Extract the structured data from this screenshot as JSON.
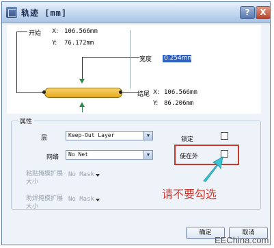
{
  "window": {
    "title": "轨迹 [mm]",
    "help_label": "?",
    "close_label": "X"
  },
  "drawing": {
    "start_label": "开始",
    "start_x_label": "X:",
    "start_x_value": "106.566mm",
    "start_y_label": "Y:",
    "start_y_value": "76.172mm",
    "width_label": "宽度",
    "width_value": "0.254mm",
    "end_label": "结尾",
    "end_x_label": "X:",
    "end_x_value": "106.566mm",
    "end_y_label": "Y:",
    "end_y_value": "86.206mm"
  },
  "properties": {
    "group_label": "属性",
    "layer_label": "层",
    "layer_value": "Keep-Out Layer",
    "net_label": "网络",
    "net_value": "No Net",
    "locked_label": "锁定",
    "keepout_label": "使在外",
    "paste_mask_label": "粘贴掩模扩展大小",
    "paste_mask_value": "No Mask",
    "solder_mask_label": "助焊掩模扩展大小",
    "solder_mask_value": "No Mask"
  },
  "annotation": "请不要勾选",
  "buttons": {
    "ok_label": "确定",
    "cancel_label": "取消"
  },
  "watermark": "EEChina.com",
  "colors": {
    "track_fill": "#e7a91d",
    "annotation_red": "#c8392b",
    "arrow_green": "#2f8a4a",
    "selection_blue": "#3161c4",
    "callout_cyan": "#3cc4d6"
  }
}
